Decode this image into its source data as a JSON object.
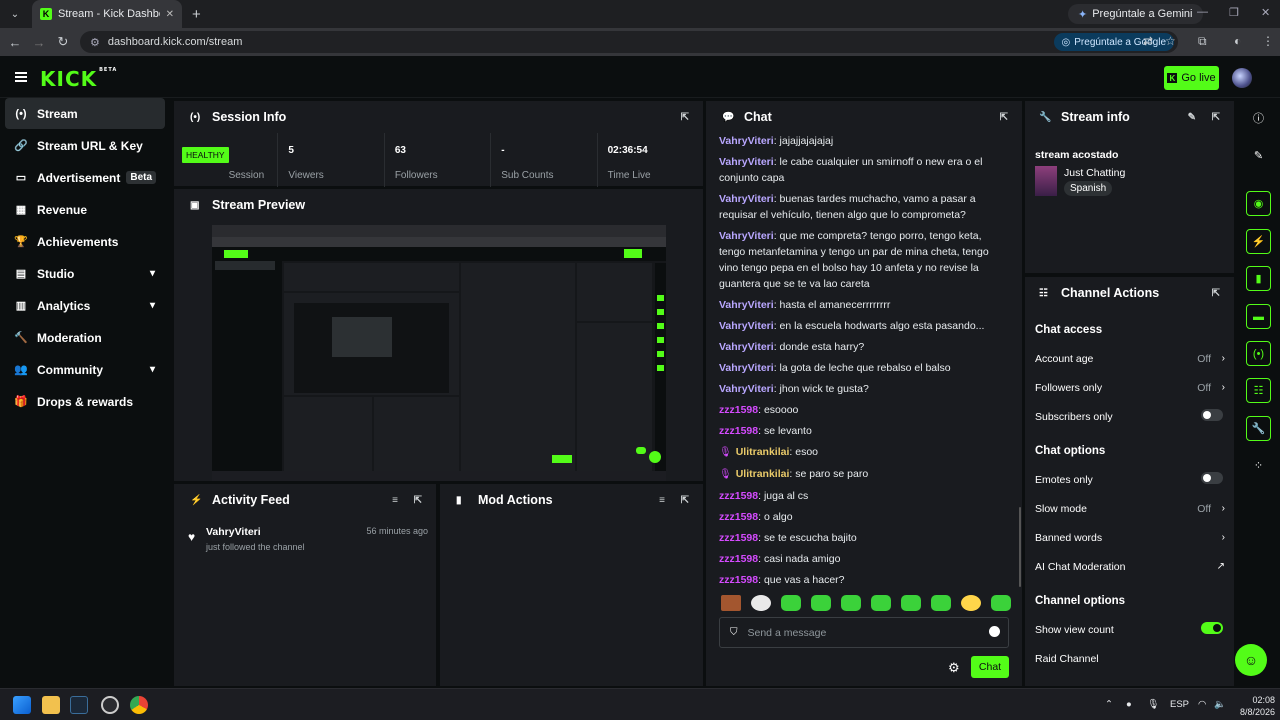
{
  "browser": {
    "tab_title": "Stream - Kick Dashboard",
    "gemini_label": "Pregúntale a Gemini",
    "url": "dashboard.kick.com/stream",
    "ask_google_label": "Pregúntale a Google"
  },
  "header": {
    "logo": "KICK",
    "logo_badge": "BETA",
    "go_live_label": "Go live"
  },
  "sidebar": {
    "items": [
      {
        "label": "Stream",
        "icon": "signal-icon"
      },
      {
        "label": "Stream URL & Key",
        "icon": "link-icon"
      },
      {
        "label": "Advertisement",
        "icon": "ad-icon",
        "badge": "Beta"
      },
      {
        "label": "Revenue",
        "icon": "chart-icon"
      },
      {
        "label": "Achievements",
        "icon": "trophy-icon"
      },
      {
        "label": "Studio",
        "icon": "studio-icon"
      },
      {
        "label": "Analytics",
        "icon": "analytics-icon"
      },
      {
        "label": "Moderation",
        "icon": "hammer-icon"
      },
      {
        "label": "Community",
        "icon": "people-icon"
      },
      {
        "label": "Drops & rewards",
        "icon": "gift-icon"
      }
    ]
  },
  "session_info": {
    "title": "Session Info",
    "status": "HEALTHY",
    "status_label": "Session",
    "stats": [
      {
        "value": "5",
        "label": "Viewers"
      },
      {
        "value": "63",
        "label": "Followers"
      },
      {
        "value": "-",
        "label": "Sub Counts"
      },
      {
        "value": "02:36:54",
        "label": "Time Live"
      }
    ]
  },
  "stream_preview": {
    "title": "Stream Preview"
  },
  "activity_feed": {
    "title": "Activity Feed",
    "items": [
      {
        "name": "VahryViteri",
        "text": "just followed the channel",
        "time": "56 minutes ago"
      }
    ]
  },
  "mod_actions": {
    "title": "Mod Actions"
  },
  "chat": {
    "title": "Chat",
    "messages": [
      {
        "user": "VahryViteri",
        "text": "jajajjajajajaj",
        "style": "u1"
      },
      {
        "user": "VahryViteri",
        "text": "le cabe cualquier un smirnoff o new era o el conjunto capa",
        "style": "u1"
      },
      {
        "user": "VahryViteri",
        "text": "buenas tardes muchacho, vamo a pasar a requisar el vehículo, tienen algo que lo comprometa?",
        "style": "u1"
      },
      {
        "user": "VahryViteri",
        "text": "que me compreta? tengo porro, tengo keta, tengo metanfetamina y tengo un par de mina cheta, tengo vino tengo pepa en el bolso hay 10 anfeta y no revise la guantera que se te va lao careta",
        "style": "u1"
      },
      {
        "user": "VahryViteri",
        "text": "hasta el amanecerrrrrrrr",
        "style": "u1"
      },
      {
        "user": "VahryViteri",
        "text": "en la escuela hodwarts algo esta pasando...",
        "style": "u1"
      },
      {
        "user": "VahryViteri",
        "text": "donde esta harry?",
        "style": "u1"
      },
      {
        "user": "VahryViteri",
        "text": "la gota de leche que rebalso el balso",
        "style": "u1"
      },
      {
        "user": "VahryViteri",
        "text": "jhon wick te gusta?",
        "style": "u1"
      },
      {
        "user": "zzz1598",
        "text": "esoooo",
        "style": "u2"
      },
      {
        "user": "zzz1598",
        "text": "se levanto",
        "style": "u2"
      },
      {
        "user": "Ulitrankilai",
        "text": "esoo",
        "style": "u3"
      },
      {
        "user": "Ulitrankilai",
        "text": "se paro se paro",
        "style": "u3"
      },
      {
        "user": "zzz1598",
        "text": "juga al cs",
        "style": "u2"
      },
      {
        "user": "zzz1598",
        "text": "o algo",
        "style": "u2"
      },
      {
        "user": "zzz1598",
        "text": "se te escucha bajito",
        "style": "u2"
      },
      {
        "user": "zzz1598",
        "text": "casi nada amigo",
        "style": "u2"
      },
      {
        "user": "zzz1598",
        "text": "que vas a hacer?",
        "style": "u2"
      }
    ],
    "input_placeholder": "Send a message",
    "send_label": "Chat"
  },
  "stream_info": {
    "title": "Stream info",
    "stream_title": "stream acostado",
    "category": "Just Chatting",
    "tag": "Spanish"
  },
  "channel_actions": {
    "title": "Channel Actions",
    "chat_access_title": "Chat access",
    "account_age_label": "Account age",
    "account_age_value": "Off",
    "followers_only_label": "Followers only",
    "followers_only_value": "Off",
    "subscribers_only_label": "Subscribers only",
    "chat_options_title": "Chat options",
    "emotes_only_label": "Emotes only",
    "slow_mode_label": "Slow mode",
    "slow_mode_value": "Off",
    "banned_words_label": "Banned words",
    "ai_moderation_label": "AI Chat Moderation",
    "channel_options_title": "Channel options",
    "show_view_count_label": "Show view count",
    "raid_channel_label": "Raid Channel"
  },
  "taskbar": {
    "lang": "ESP",
    "time": "02:08",
    "date": "8/8/2026"
  },
  "colors": {
    "accent": "#53fc18",
    "panel": "#191b1f",
    "bg": "#0b0e0f"
  }
}
